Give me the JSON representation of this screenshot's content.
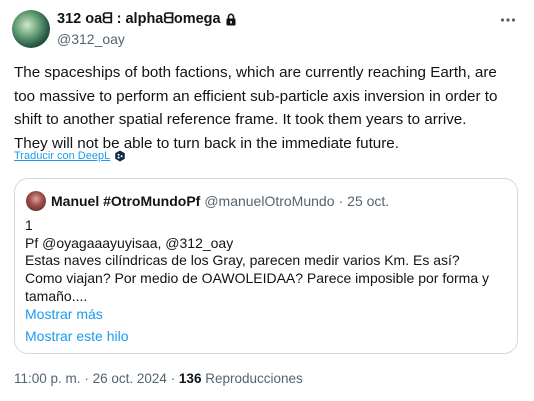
{
  "author": {
    "name": "312 oaᗺ : alphaᗺomega",
    "handle": "@312_oay"
  },
  "tweet": {
    "lines": [
      "The spaceships of both factions, which are currently reaching Earth, are",
      "too massive to perform an efficient sub-particle axis inversion in order to",
      "shift to another spatial reference frame. It took them years to arrive.",
      "They will not be able to turn back in the immediate future."
    ],
    "translate_label": "Traducir con DeepL"
  },
  "quote": {
    "name": "Manuel #OtroMundoPf",
    "handle": "@manuelOtroMundo",
    "separator": "·",
    "date": "25 oct.",
    "lines": [
      "1",
      "Pf @oyagaaayuyisaa, @312_oay",
      "Estas naves cilíndricas de los Gray, parecen medir varios Km. Es así?",
      "Como viajan? Por medio de OAWOLEIDAA? Parece imposible por forma y",
      "tamaño...."
    ],
    "show_more": "Mostrar más",
    "show_thread": "Mostrar este hilo"
  },
  "meta": {
    "time": "11:00 p. m.",
    "separator": "·",
    "date": "26 oct. 2024",
    "views_count": "136",
    "views_label": "Reproducciones"
  },
  "colors": {
    "link": "#1d9bf0",
    "secondary_text": "#536471",
    "border": "#cfd9de"
  },
  "icons": [
    "lock-icon",
    "more-options-icon",
    "deepl-icon"
  ]
}
